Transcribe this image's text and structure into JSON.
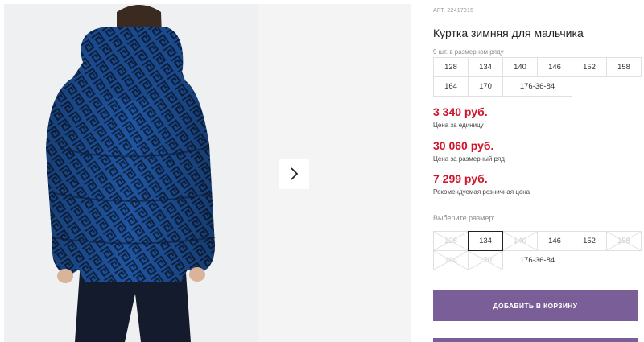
{
  "product": {
    "article": "АРТ. 22417015",
    "title": "Куртка зимняя для мальчика",
    "qty_note": "9 шт. в размерном ряду"
  },
  "pack_sizes": [
    "128",
    "134",
    "140",
    "146",
    "152",
    "158",
    "164",
    "170",
    "176-36-84"
  ],
  "prices": [
    {
      "value": "3 340 руб.",
      "caption": "Цена за единицу"
    },
    {
      "value": "30 060 руб.",
      "caption": "Цена за размерный ряд"
    },
    {
      "value": "7 299 руб.",
      "caption": "Рекомендуемая розничная цена"
    }
  ],
  "choose": {
    "label": "Выберите размер:",
    "sizes": [
      {
        "label": "128",
        "state": "disabled"
      },
      {
        "label": "134",
        "state": "selected"
      },
      {
        "label": "140",
        "state": "disabled"
      },
      {
        "label": "146",
        "state": "available"
      },
      {
        "label": "152",
        "state": "available"
      },
      {
        "label": "158",
        "state": "disabled"
      },
      {
        "label": "164",
        "state": "disabled"
      },
      {
        "label": "170",
        "state": "disabled"
      },
      {
        "label": "176-36-84",
        "state": "available"
      }
    ]
  },
  "cart_button": "ДОБАВИТЬ В КОРЗИНУ",
  "gallery": {
    "next_icon": "chevron-right-icon"
  },
  "colors": {
    "price": "#d0152a",
    "accent": "#7a5e97",
    "jacket": "#1d4f8c"
  }
}
